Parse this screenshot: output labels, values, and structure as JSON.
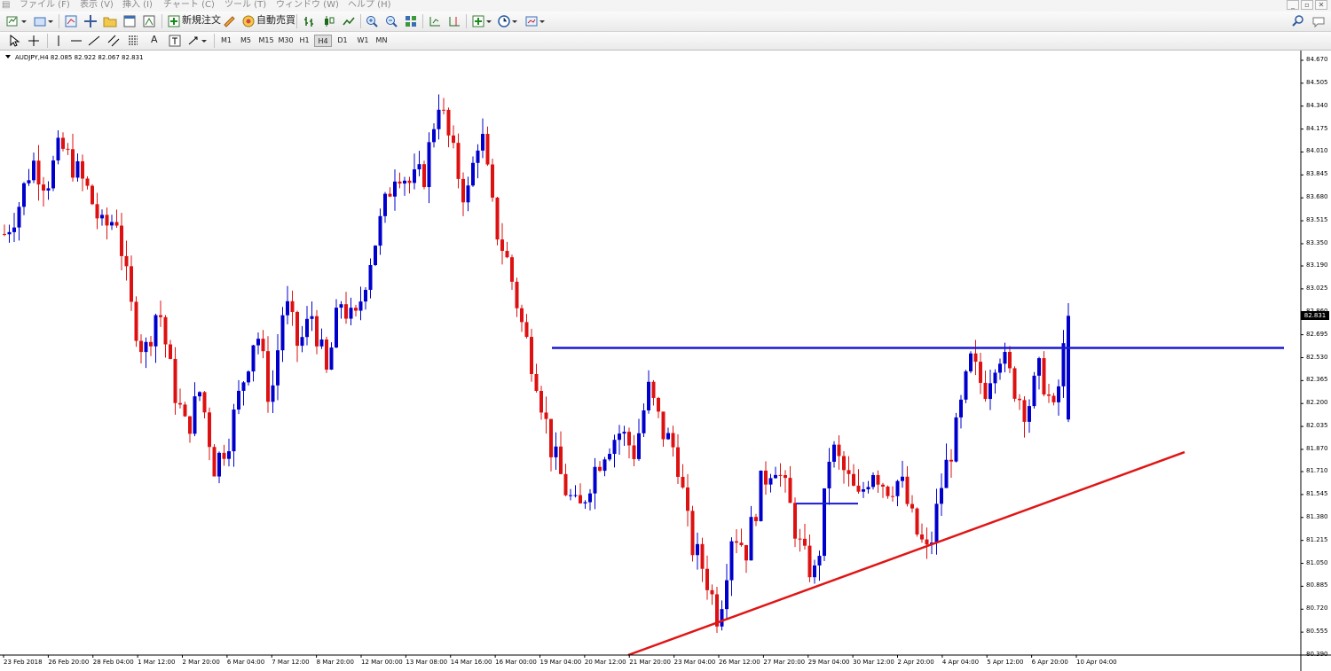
{
  "menu": {
    "items": [
      "ファイル (F)",
      "表示 (V)",
      "挿入 (I)",
      "チャート (C)",
      "ツール (T)",
      "ウィンドウ (W)",
      "ヘルプ (H)"
    ],
    "window_controls": [
      "_",
      "▫",
      "✕"
    ]
  },
  "toolbar": {
    "new_order_label": "新規注文",
    "auto_trade_label": "自動売買",
    "timeframes": [
      "M1",
      "M5",
      "M15",
      "M30",
      "H1",
      "H4",
      "D1",
      "W1",
      "MN"
    ],
    "active_timeframe": "H4",
    "text_tool_label": "A"
  },
  "chart": {
    "symbol_info": "AUDJPY,H4  82.085 82.922 82.067 82.831",
    "current_price": "82.831",
    "colors": {
      "bull": "#0000cc",
      "bear": "#dd1111",
      "resistance": "#1a1ad0",
      "support": "#e01515"
    }
  },
  "chart_data": {
    "type": "candlestick",
    "symbol": "AUDJPY",
    "timeframe": "H4",
    "ohlc_last": {
      "open": 82.085,
      "high": 82.922,
      "low": 82.067,
      "close": 82.831
    },
    "y_ticks": [
      "84.670",
      "84.505",
      "84.340",
      "84.175",
      "84.010",
      "83.845",
      "83.680",
      "83.515",
      "83.350",
      "83.190",
      "83.025",
      "82.860",
      "82.695",
      "82.530",
      "82.365",
      "82.200",
      "82.035",
      "81.870",
      "81.710",
      "81.545",
      "81.380",
      "81.215",
      "81.050",
      "80.885",
      "80.720",
      "80.555",
      "80.390"
    ],
    "x_ticks": [
      "23 Feb 2018",
      "26 Feb 20:00",
      "28 Feb 04:00",
      "1 Mar 12:00",
      "2 Mar 20:00",
      "6 Mar 04:00",
      "7 Mar 12:00",
      "8 Mar 20:00",
      "12 Mar 00:00",
      "13 Mar 08:00",
      "14 Mar 16:00",
      "16 Mar 00:00",
      "19 Mar 04:00",
      "20 Mar 12:00",
      "21 Mar 20:00",
      "23 Mar 04:00",
      "26 Mar 12:00",
      "27 Mar 20:00",
      "29 Mar 04:00",
      "30 Mar 12:00",
      "2 Apr 20:00",
      "4 Apr 04:00",
      "5 Apr 12:00",
      "6 Apr 20:00",
      "10 Apr 04:00"
    ],
    "ylim": [
      80.39,
      84.67
    ],
    "close_path": [
      83.42,
      83.62,
      83.95,
      83.78,
      84.05,
      83.9,
      83.72,
      83.45,
      83.55,
      82.9,
      82.55,
      82.92,
      82.35,
      82.0,
      82.3,
      81.75,
      81.95,
      82.35,
      82.75,
      82.2,
      82.95,
      82.6,
      82.85,
      82.4,
      82.95,
      82.75,
      83.2,
      83.55,
      83.92,
      83.78,
      83.85,
      84.4,
      84.0,
      83.65,
      84.2,
      83.5,
      83.2,
      82.75,
      82.4,
      81.9,
      81.6,
      81.4,
      81.7,
      81.9,
      82.0,
      81.85,
      82.3,
      82.0,
      81.85,
      81.2,
      81.0,
      80.65,
      81.3,
      81.15,
      81.6,
      81.8,
      81.5,
      81.1,
      80.95,
      81.9,
      81.7,
      81.5,
      81.75,
      81.6,
      81.65,
      81.3,
      81.1,
      81.65,
      82.0,
      82.5,
      82.3,
      82.6,
      82.35,
      82.15,
      82.45,
      82.1,
      82.831
    ],
    "annotations": [
      {
        "type": "horizontal_line",
        "price": 82.6,
        "color": "#1a1ad0"
      },
      {
        "type": "horizontal_line",
        "price": 81.48,
        "color": "#1a1ad0"
      },
      {
        "type": "trend_line",
        "from_price": 80.39,
        "to_price": 81.85,
        "color": "#e01515"
      }
    ]
  }
}
